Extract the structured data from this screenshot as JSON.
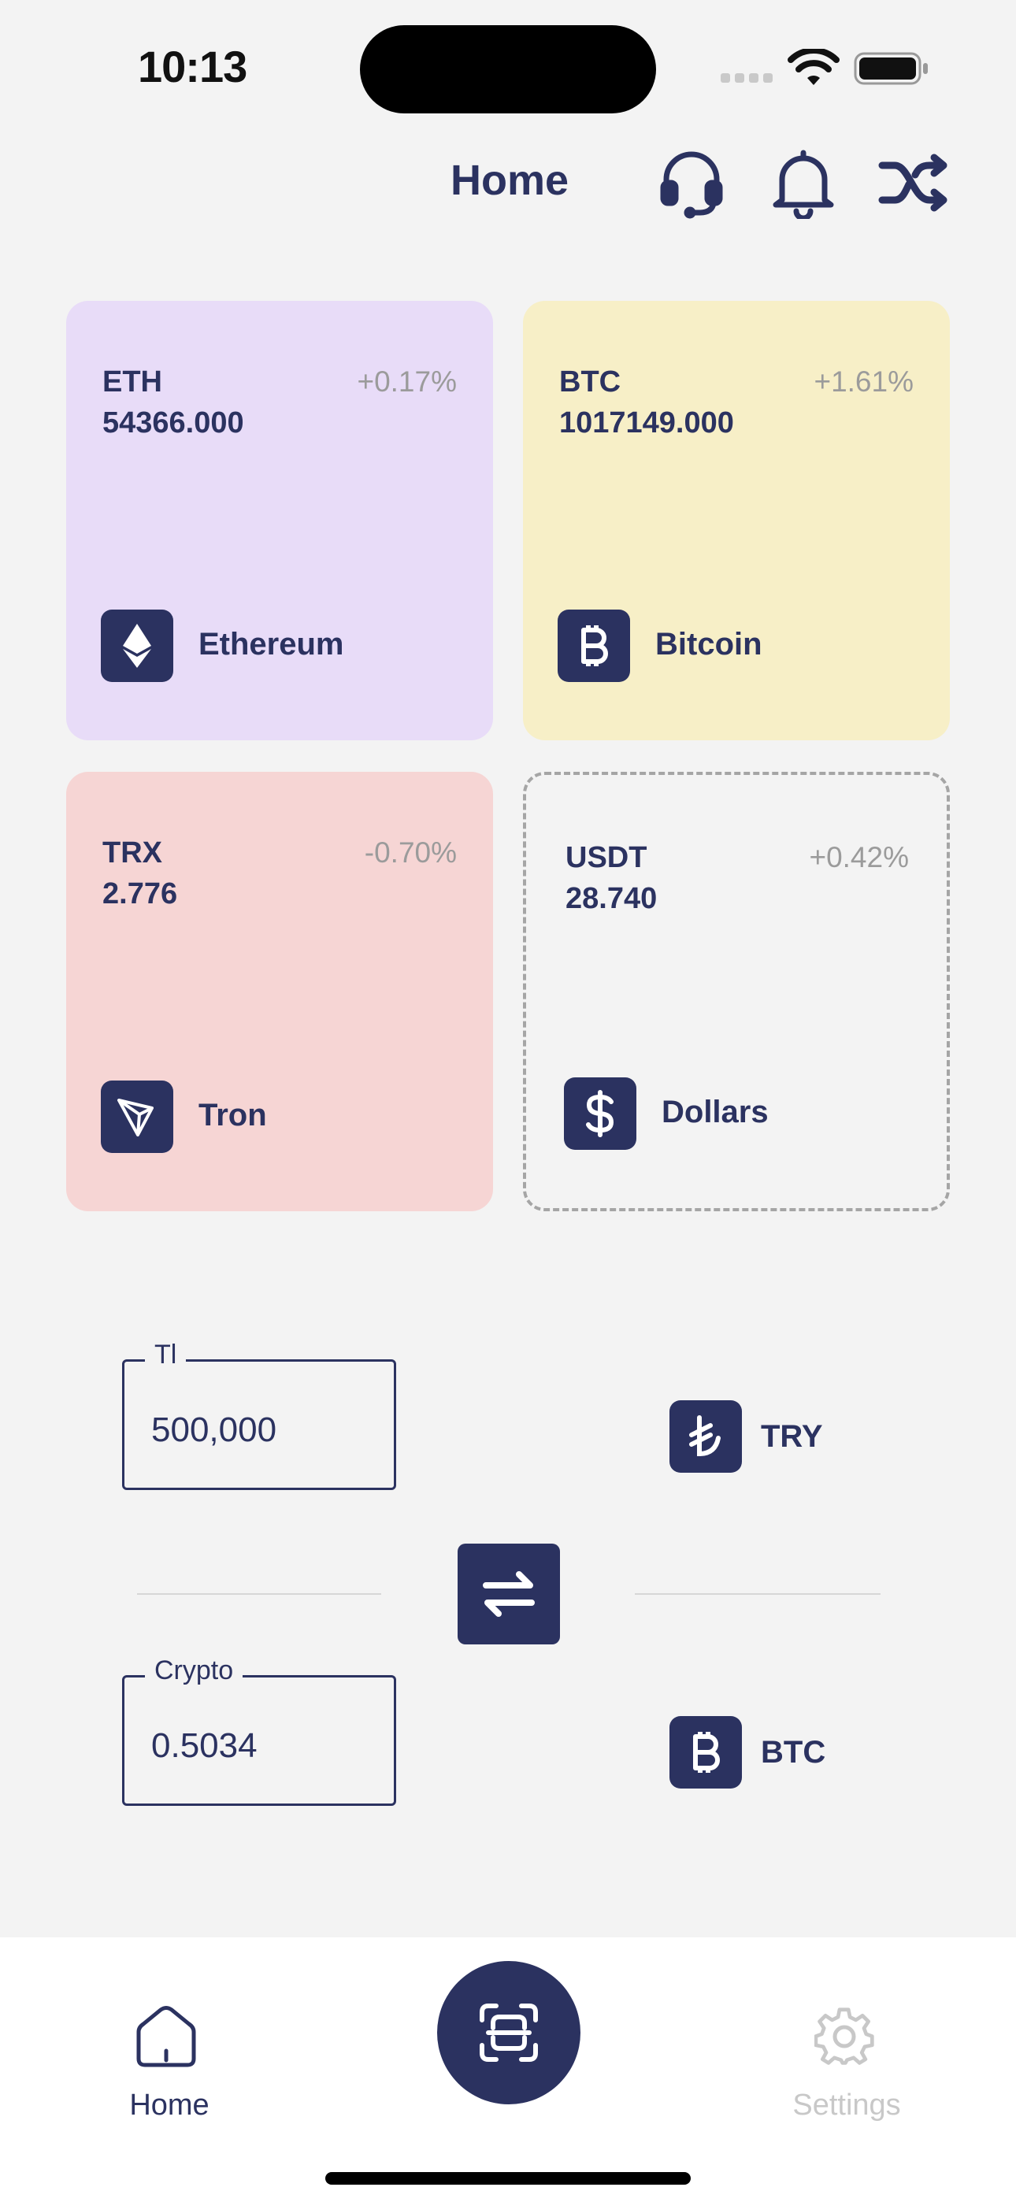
{
  "status_bar": {
    "time": "10:13"
  },
  "header": {
    "title": "Home",
    "icons": [
      "headset-icon",
      "bell-icon",
      "shuffle-icon"
    ]
  },
  "cards": [
    {
      "symbol": "ETH",
      "price": "54366.000",
      "change": "+0.17%",
      "name": "Ethereum",
      "icon": "ethereum-icon",
      "bg": "#e8dcf8"
    },
    {
      "symbol": "BTC",
      "price": "1017149.000",
      "change": "+1.61%",
      "name": "Bitcoin",
      "icon": "bitcoin-icon",
      "bg": "#f7efc7"
    },
    {
      "symbol": "TRX",
      "price": "2.776",
      "change": "-0.70%",
      "name": "Tron",
      "icon": "tron-icon",
      "bg": "#f6d5d4"
    },
    {
      "symbol": "USDT",
      "price": "28.740",
      "change": "+0.42%",
      "name": "Dollars",
      "icon": "dollar-icon",
      "style": "dashed"
    }
  ],
  "converter": {
    "fiat": {
      "legend": "Tl",
      "value": "500,000",
      "currency": "TRY",
      "icon": "lira-icon"
    },
    "crypto": {
      "legend": "Crypto",
      "value": "0.5034",
      "currency": "BTC",
      "icon": "bitcoin-icon"
    },
    "swap_icon": "swap-arrows-icon"
  },
  "bottom_nav": {
    "home_label": "Home",
    "settings_label": "Settings",
    "scan_icon": "scan-icon",
    "active": "home"
  },
  "colors": {
    "primary": "#2b3260",
    "background": "#f3f3f3",
    "muted": "#9b9b9b",
    "inactive": "#c8c8c8"
  }
}
